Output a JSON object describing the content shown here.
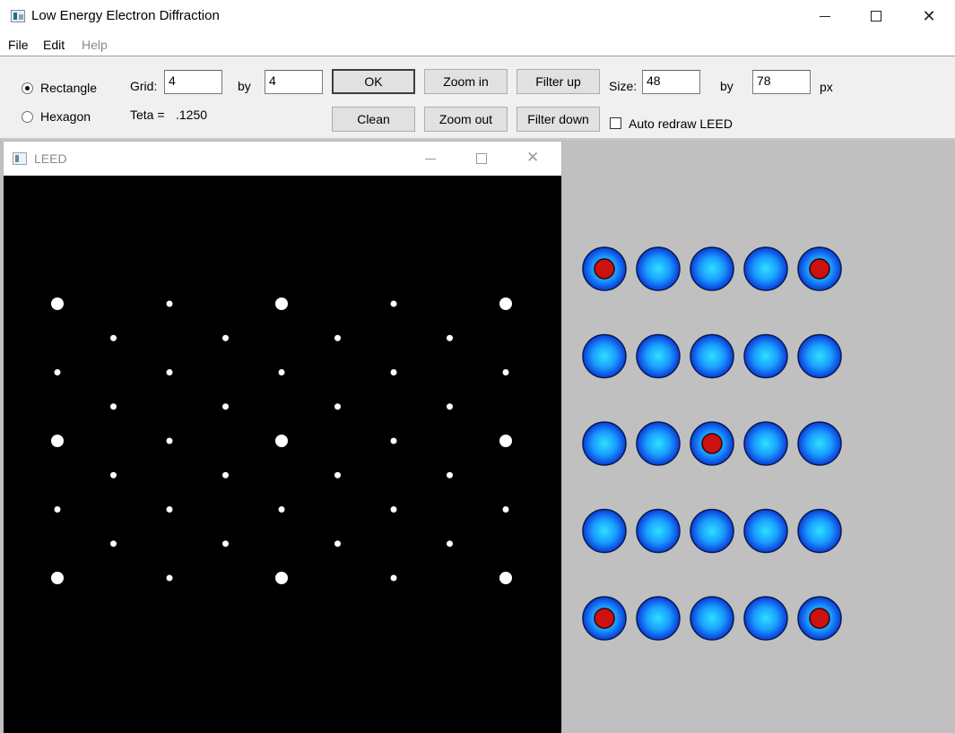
{
  "window": {
    "title": "Low Energy Electron Diffraction",
    "minimize_glyph": "",
    "maximize_glyph": "",
    "close_glyph": "✕"
  },
  "menu": {
    "file": "File",
    "edit": "Edit",
    "help": "Help"
  },
  "toolbar": {
    "rectangle_label": "Rectangle",
    "hexagon_label": "Hexagon",
    "shape_selected": "Rectangle",
    "grid_label": "Grid:",
    "grid_x": "4",
    "grid_by_label": "by",
    "grid_y": "4",
    "teta_label": "Teta =",
    "teta_value": ".1250",
    "ok_label": "OK",
    "clean_label": "Clean",
    "zoom_in_label": "Zoom in",
    "zoom_out_label": "Zoom out",
    "filter_up_label": "Filter up",
    "filter_down_label": "Filter down",
    "size_label": "Size:",
    "size_x": "48",
    "size_by_label": "by",
    "size_y": "78",
    "size_unit": "px",
    "auto_redraw_label": "Auto redraw LEED",
    "auto_redraw_checked": false
  },
  "leed_window": {
    "title": "LEED",
    "close_glyph": "✕"
  },
  "colors": {
    "workspace_bg": "#c0c0c0",
    "atom_blue": "#1e90ff",
    "atom_center": "#22ccff",
    "atom_outline": "#0a1a4a",
    "adsorbate_red": "#cc1111",
    "spot": "#ffffff",
    "canvas_bg": "#000000"
  },
  "diffraction_pattern": {
    "large_spots": [
      {
        "col": 0,
        "row": 0
      },
      {
        "col": 4,
        "row": 0
      },
      {
        "col": 8,
        "row": 0
      },
      {
        "col": 0,
        "row": 4
      },
      {
        "col": 4,
        "row": 4
      },
      {
        "col": 8,
        "row": 4
      },
      {
        "col": 0,
        "row": 8
      },
      {
        "col": 4,
        "row": 8
      },
      {
        "col": 8,
        "row": 8
      }
    ],
    "description_of_grid": "9 columns x 9 rows of spots in a centered pattern"
  },
  "lattice": {
    "rows": 5,
    "cols": 5,
    "adsorbate_positions": [
      {
        "row": 0,
        "col": 0
      },
      {
        "row": 0,
        "col": 4
      },
      {
        "row": 2,
        "col": 2
      },
      {
        "row": 4,
        "col": 0
      },
      {
        "row": 4,
        "col": 4
      }
    ]
  }
}
